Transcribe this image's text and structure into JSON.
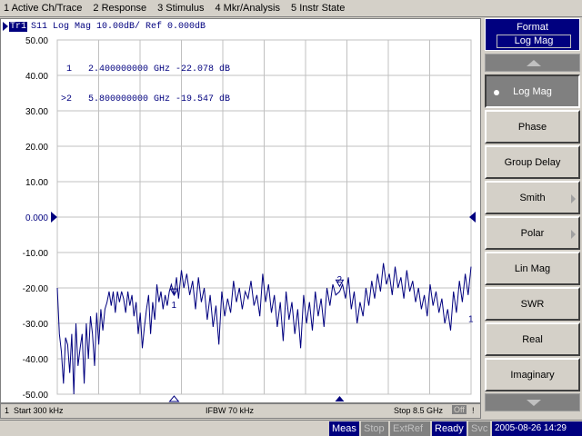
{
  "menu": {
    "items": [
      "1 Active Ch/Trace",
      "2 Response",
      "3 Stimulus",
      "4 Mkr/Analysis",
      "5 Instr State"
    ]
  },
  "trace": {
    "id": "Tr1",
    "header": "S11 Log Mag 10.00dB/ Ref 0.000dB"
  },
  "markers": {
    "readout": [
      " 1   2.400000000 GHz -22.078 dB",
      ">2   5.800000000 GHz -19.547 dB"
    ],
    "labels": [
      "1",
      "2",
      "1"
    ]
  },
  "status": {
    "channel": "1",
    "start": "Start 300 kHz",
    "ifbw": "IFBW 70 kHz",
    "stop": "Stop 8.5 GHz",
    "off": "Off",
    "bang": "!"
  },
  "bottom_bar": {
    "meas": "Meas",
    "stop": "Stop",
    "extref": "ExtRef",
    "ready": "Ready",
    "svc": "Svc",
    "datetime": "2005-08-26 14:29"
  },
  "softkeys": {
    "title": "Format",
    "current": "Log Mag",
    "buttons": [
      {
        "label": "Log Mag",
        "selected": true,
        "submenu": false
      },
      {
        "label": "Phase",
        "selected": false,
        "submenu": false
      },
      {
        "label": "Group Delay",
        "selected": false,
        "submenu": false
      },
      {
        "label": "Smith",
        "selected": false,
        "submenu": true
      },
      {
        "label": "Polar",
        "selected": false,
        "submenu": true
      },
      {
        "label": "Lin Mag",
        "selected": false,
        "submenu": false
      },
      {
        "label": "SWR",
        "selected": false,
        "submenu": false
      },
      {
        "label": "Real",
        "selected": false,
        "submenu": false
      },
      {
        "label": "Imaginary",
        "selected": false,
        "submenu": false
      }
    ]
  },
  "colors": {
    "trace": "#00007f",
    "grid": "#c0c0c0",
    "accent": "#00007f",
    "panel": "#d4d0c8"
  },
  "chart_data": {
    "type": "line",
    "y_tick_labels": [
      "50.00",
      "40.00",
      "30.00",
      "20.00",
      "10.00",
      "0.000",
      "-10.00",
      "-20.00",
      "-30.00",
      "-40.00",
      "-50.00"
    ],
    "ylim": [
      -50,
      50
    ],
    "xlim_ghz": [
      0.0003,
      8.5
    ],
    "reference_level": 0,
    "grid": true,
    "series": [
      {
        "x_ghz": [
          0.0003,
          0.043,
          0.085,
          0.128,
          0.171,
          0.213,
          0.256,
          0.298,
          0.341,
          0.384,
          0.426,
          0.469,
          0.511,
          0.554,
          0.597,
          0.639,
          0.682,
          0.724,
          0.767,
          0.81,
          0.852,
          0.895,
          0.937,
          0.98,
          1.023,
          1.065,
          1.108,
          1.15,
          1.193,
          1.236,
          1.278,
          1.321,
          1.363,
          1.406,
          1.449,
          1.491,
          1.534,
          1.576,
          1.619,
          1.662,
          1.704,
          1.747,
          1.789,
          1.832,
          1.875,
          1.917,
          1.96,
          2.002,
          2.045,
          2.088,
          2.13,
          2.173,
          2.215,
          2.258,
          2.301,
          2.343,
          2.4,
          2.45,
          2.49,
          2.55,
          2.6,
          2.66,
          2.72,
          2.78,
          2.84,
          2.9,
          2.96,
          3.02,
          3.08,
          3.14,
          3.2,
          3.26,
          3.32,
          3.38,
          3.44,
          3.5,
          3.56,
          3.62,
          3.68,
          3.74,
          3.8,
          3.86,
          3.92,
          3.98,
          4.04,
          4.1,
          4.16,
          4.22,
          4.28,
          4.34,
          4.4,
          4.46,
          4.52,
          4.58,
          4.64,
          4.7,
          4.76,
          4.82,
          4.88,
          4.94,
          5.0,
          5.06,
          5.12,
          5.18,
          5.24,
          5.3,
          5.36,
          5.42,
          5.48,
          5.54,
          5.6,
          5.66,
          5.72,
          5.8,
          5.86,
          5.92,
          5.98,
          6.04,
          6.1,
          6.16,
          6.22,
          6.28,
          6.34,
          6.4,
          6.46,
          6.52,
          6.58,
          6.64,
          6.7,
          6.76,
          6.82,
          6.88,
          6.94,
          7.0,
          7.06,
          7.12,
          7.18,
          7.24,
          7.3,
          7.36,
          7.42,
          7.48,
          7.54,
          7.6,
          7.66,
          7.72,
          7.78,
          7.84,
          7.9,
          7.96,
          8.02,
          8.08,
          8.14,
          8.2,
          8.26,
          8.32,
          8.38,
          8.44,
          8.5
        ],
        "y_db": [
          -20,
          -33,
          -38,
          -47,
          -34,
          -36,
          -44,
          -33,
          -50,
          -30,
          -42,
          -37,
          -33,
          -47,
          -30,
          -40,
          -28,
          -33,
          -42,
          -27,
          -36,
          -26,
          -32,
          -26,
          -24,
          -21,
          -25,
          -21,
          -27,
          -21,
          -24,
          -21,
          -23,
          -27,
          -21,
          -25,
          -22,
          -28,
          -24,
          -33,
          -27,
          -37,
          -31,
          -26,
          -22,
          -33,
          -24,
          -29,
          -19,
          -24,
          -21,
          -26,
          -22,
          -25,
          -21,
          -19,
          -22,
          -17,
          -23,
          -15,
          -20,
          -16,
          -22,
          -18,
          -26,
          -17,
          -24,
          -20,
          -29,
          -22,
          -31,
          -25,
          -36,
          -21,
          -28,
          -23,
          -27,
          -18,
          -24,
          -20,
          -26,
          -21,
          -23,
          -18,
          -25,
          -22,
          -28,
          -16,
          -24,
          -19,
          -27,
          -22,
          -31,
          -24,
          -35,
          -21,
          -29,
          -24,
          -33,
          -26,
          -37,
          -22,
          -30,
          -24,
          -32,
          -21,
          -28,
          -23,
          -31,
          -20,
          -25,
          -19,
          -22,
          -21,
          -19,
          -23,
          -17,
          -26,
          -21,
          -30,
          -24,
          -28,
          -20,
          -25,
          -18,
          -23,
          -16,
          -21,
          -13,
          -19,
          -16,
          -22,
          -14,
          -20,
          -17,
          -23,
          -15,
          -21,
          -18,
          -24,
          -20,
          -26,
          -22,
          -28,
          -19,
          -25,
          -21,
          -27,
          -23,
          -30,
          -26,
          -32,
          -21,
          -27,
          -18,
          -24,
          -16,
          -22,
          -14,
          -20,
          -18,
          -23,
          -15,
          -21,
          -25,
          -27,
          -30
        ]
      }
    ]
  }
}
